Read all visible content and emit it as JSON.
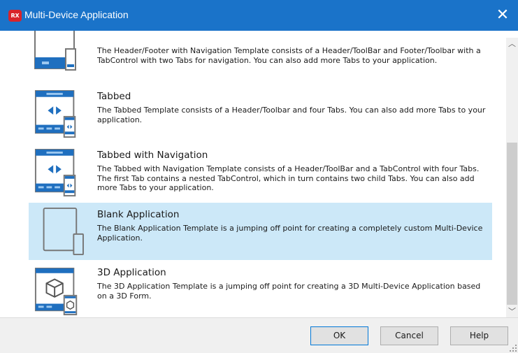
{
  "window": {
    "title": "Multi-Device Application",
    "app_icon_text": "RX",
    "close_glyph": "✕"
  },
  "templates": [
    {
      "title": "",
      "description": "The Header/Footer with Navigation Template consists of a Header/ToolBar and Footer/Toolbar with a TabControl with two Tabs for navigation.  You can also add more Tabs to your application.",
      "icon": "header-footer-navigation-icon",
      "selected": false
    },
    {
      "title": "Tabbed",
      "description": "The Tabbed Template consists of a Header/Toolbar and four Tabs.  You can also add more Tabs to your application.",
      "icon": "tabbed-template-icon",
      "selected": false
    },
    {
      "title": "Tabbed with Navigation",
      "description": "The Tabbed with Navigation Template consists of a Header/ToolBar and a TabControl with four Tabs. The first Tab contains a nested TabControl, which in turn contains two child Tabs. You can also add more Tabs to your application.",
      "icon": "tabbed-navigation-template-icon",
      "selected": false
    },
    {
      "title": "Blank Application",
      "description": "The Blank Application Template is a jumping off point for creating a completely custom Multi-Device Application.",
      "icon": "blank-application-icon",
      "selected": true
    },
    {
      "title": "3D Application",
      "description": "The 3D Application Template is a jumping off point for creating a 3D Multi-Device Application based on a 3D Form.",
      "icon": "3d-application-icon",
      "selected": false
    }
  ],
  "buttons": {
    "ok": "OK",
    "cancel": "Cancel",
    "help": "Help"
  },
  "scrollbar": {
    "up_glyph": "︿",
    "down_glyph": "﹀"
  },
  "colors": {
    "titlebar": "#1a73c9",
    "selection": "#cce8f8",
    "icon_blue": "#1f6fbf",
    "icon_gray": "#777777"
  }
}
